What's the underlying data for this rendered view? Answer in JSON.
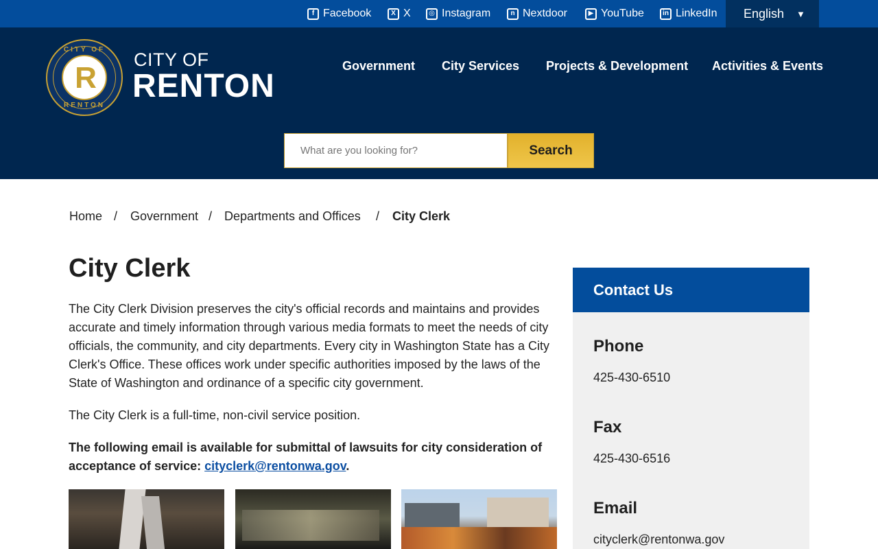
{
  "social": [
    {
      "label": "Facebook",
      "icon": "facebook-icon",
      "glyph": "f"
    },
    {
      "label": "X",
      "icon": "x-icon",
      "glyph": "X"
    },
    {
      "label": "Instagram",
      "icon": "instagram-icon",
      "glyph": "◎"
    },
    {
      "label": "Nextdoor",
      "icon": "nextdoor-icon",
      "glyph": "n"
    },
    {
      "label": "YouTube",
      "icon": "youtube-icon",
      "glyph": "▶"
    },
    {
      "label": "LinkedIn",
      "icon": "linkedin-icon",
      "glyph": "in"
    }
  ],
  "language": {
    "selected": "English",
    "caret": "▼"
  },
  "brand": {
    "line1": "CITY OF",
    "line2": "RENTON",
    "seal_top": "CITY OF",
    "seal_bottom": "RENTON",
    "seal_letter": "R"
  },
  "nav": [
    "Government",
    "City Services",
    "Projects & Development",
    "Activities & Events"
  ],
  "search": {
    "placeholder": "What are you looking for?",
    "button": "Search"
  },
  "breadcrumb": {
    "items": [
      "Home",
      "Government",
      "Departments and Offices",
      "City Clerk"
    ],
    "separator": "/"
  },
  "main": {
    "title": "City Clerk",
    "para1": "The City Clerk Division preserves the city's official records and maintains and provides accurate and timely information through various media formats to meet the needs of city officials, the community, and city departments. Every city in Washington State has a City Clerk's Office. These offices work under specific authorities imposed by the laws of the State of Washington and ordinance of a specific city government.",
    "para2": "The City Clerk is a full-time, non-civil service position.",
    "para3_text": "The following email is available for submittal of lawsuits for city consideration of acceptance of service: ",
    "para3_link": "cityclerk@rentonwa.gov",
    "para3_end": "."
  },
  "contact": {
    "heading": "Contact Us",
    "phone_label": "Phone",
    "phone": "425-430-6510",
    "fax_label": "Fax",
    "fax": "425-430-6516",
    "email_label": "Email",
    "email": "cityclerk@rentonwa.gov"
  },
  "colors": {
    "top_bar": "#034d9c",
    "header": "#00264f",
    "accent_gold": "#e2b12c",
    "link": "#0b4ea2",
    "sidebar_bg": "#f0f0f0"
  }
}
